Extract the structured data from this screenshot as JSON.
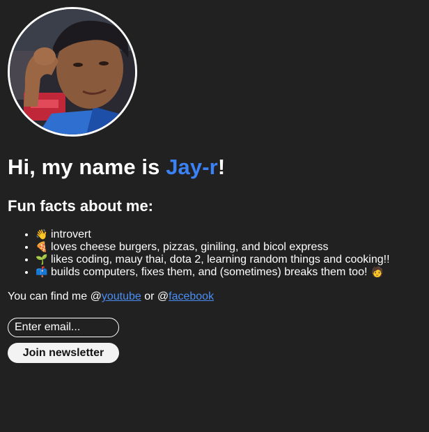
{
  "profile": {
    "avatar_icon": "profile-photo"
  },
  "heading": {
    "prefix": "Hi, my name is ",
    "name": "Jay-r",
    "suffix": "!"
  },
  "subheading": "Fun facts about me:",
  "facts": [
    {
      "emoji": "👋",
      "icon": "waving-hand-icon",
      "text": "introvert"
    },
    {
      "emoji": "🍕",
      "icon": "pizza-icon",
      "text": "loves cheese burgers, pizzas, giniling, and bicol express"
    },
    {
      "emoji": "🌱",
      "icon": "seedling-icon",
      "text": "likes coding, mauy thai, dota 2, learning random things and cooking!!"
    },
    {
      "emoji": "📫",
      "icon": "mailbox-icon",
      "text": "builds computers, fixes them, and (sometimes) breaks them too!",
      "trailing_emoji": "🧑",
      "trailing_icon": "person-icon"
    }
  ],
  "find_me": {
    "prefix": "You can find me @",
    "youtube": "youtube",
    "middle": " or @",
    "facebook": "facebook"
  },
  "newsletter": {
    "placeholder": "Enter email...",
    "button_label": "Join newsletter"
  },
  "colors": {
    "background": "#212121",
    "accent": "#3b82f6",
    "link": "#4a8ef5"
  }
}
